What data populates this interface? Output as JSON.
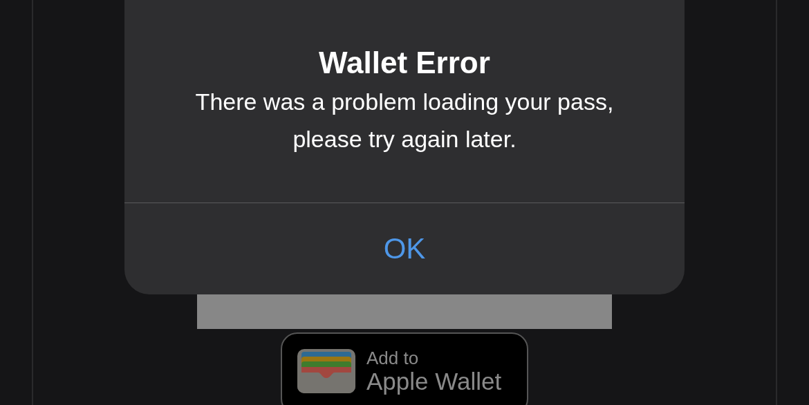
{
  "alert": {
    "title": "Wallet Error",
    "message": "There was a problem loading your pass, please try again later.",
    "buttons": [
      "OK"
    ]
  },
  "wallet_button": {
    "line_1": "Add to",
    "line_2": "Apple Wallet"
  }
}
